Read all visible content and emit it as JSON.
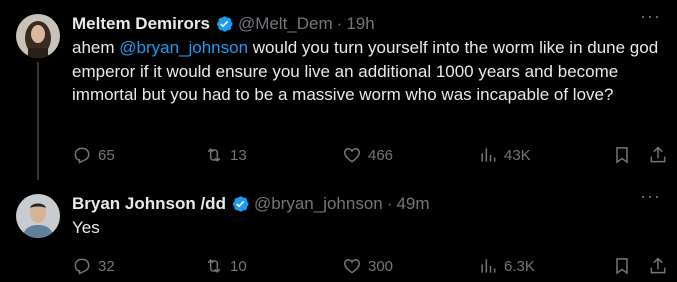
{
  "tweets": [
    {
      "name": "Meltem Demirors",
      "handle": "@Melt_Dem",
      "separator": "·",
      "time": "19h",
      "text_prefix": "ahem ",
      "mention": "@bryan_johnson",
      "text_suffix": " would you turn yourself into the worm like in dune god emperor if it would ensure you live an additional 1000 years and become immortal but you had to be a massive worm who was incapable of love?",
      "replies": "65",
      "retweets": "13",
      "likes": "466",
      "views": "43K"
    },
    {
      "name": "Bryan Johnson /dd",
      "handle": "@bryan_johnson",
      "separator": "·",
      "time": "49m",
      "text": "Yes",
      "replies": "32",
      "retweets": "10",
      "likes": "300",
      "views": "6.3K"
    }
  ],
  "more_glyph": "···",
  "colors": {
    "accent": "#1d9bf0",
    "muted": "#71767b",
    "background": "#000000",
    "text": "#e7e9ea"
  },
  "icons": [
    "verified-badge-icon",
    "reply-icon",
    "retweet-icon",
    "like-icon",
    "views-icon",
    "bookmark-icon",
    "share-icon",
    "more-icon"
  ]
}
